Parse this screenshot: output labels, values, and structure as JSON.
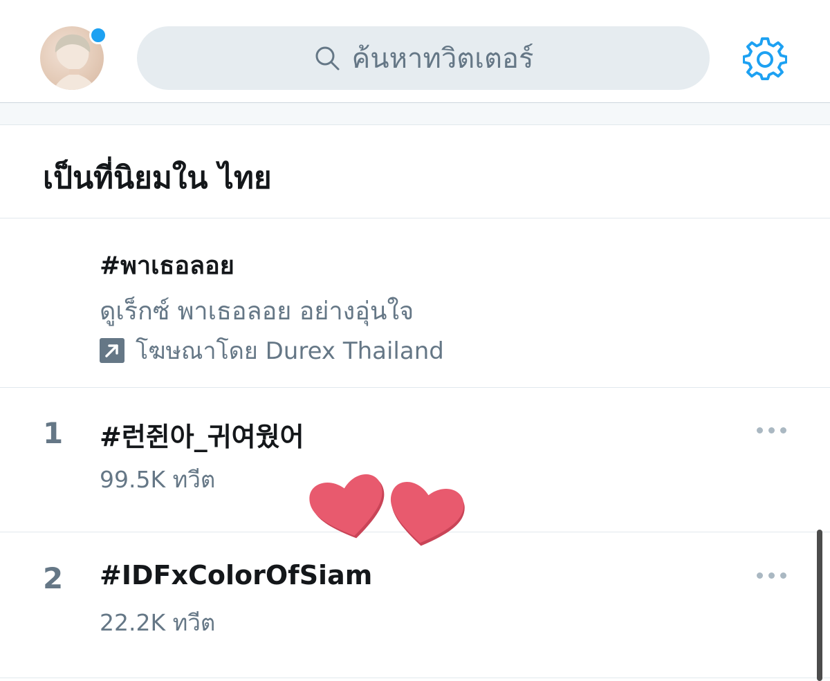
{
  "header": {
    "search_placeholder": "ค้นหาทวิตเตอร์",
    "notification_dot_color": "#1da1f2",
    "settings_icon": "gear-icon"
  },
  "section": {
    "title": "เป็นที่นิยมใน ไทย"
  },
  "promoted": {
    "tag": "#พาเธอลอย",
    "description": "ดูเร็กซ์ พาเธอลอย อย่างอุ่นใจ",
    "sponsor": "โฆษณาโดย Durex Thailand",
    "icon": "promoted-arrow-icon"
  },
  "trends": [
    {
      "rank": "1",
      "name": "#런쥔아_귀여웠어",
      "count": "99.5K ทวีต"
    },
    {
      "rank": "2",
      "name": "#IDFxColorOfSiam",
      "count": "22.2K ทวีต"
    }
  ],
  "colors": {
    "accent": "#1da1f2",
    "secondary_text": "#657786",
    "heart": "#e85a6e"
  }
}
